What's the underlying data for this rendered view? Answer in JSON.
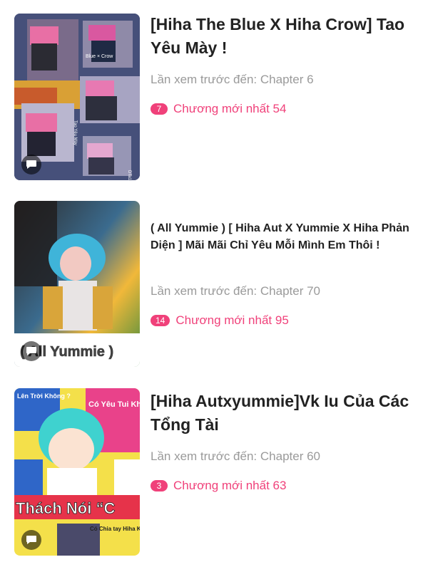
{
  "stories": [
    {
      "title": "[Hiha The Blue X Hiha Crow] Tao Yêu Mày !",
      "preview_label": "Lần xem trước đến:",
      "preview_chapter": "Chapter 6",
      "new_count": "7",
      "latest_label": "Chương mới nhất 54",
      "cover_text_1": "Blue × Crow",
      "cover_text_2": "Tao Yêu Mày"
    },
    {
      "title": "( All Yummie ) [ Hiha Aut X Yummie X Hiha Phản Diện ] Mãi Mãi Chỉ Yêu Mỗi Mình Em Thôi !",
      "preview_label": "Lần xem trước đến:",
      "preview_chapter": "Chapter 70",
      "new_count": "14",
      "latest_label": "Chương mới nhất 95",
      "cover_text_1": "( All Yummie )"
    },
    {
      "title": "[Hiha Autxyummie]Vk Iu Của Các Tổng Tài",
      "preview_label": "Lần xem trước đến:",
      "preview_chapter": "Chapter 60",
      "new_count": "3",
      "latest_label": "Chương mới nhất 63",
      "cover_text_1": "Lên Trời Không ?",
      "cover_text_2": "Có Yêu Tui Không",
      "cover_text_3": "Thách Nói “C",
      "cover_text_4": "Có Chia tay Hiha Không"
    }
  ]
}
